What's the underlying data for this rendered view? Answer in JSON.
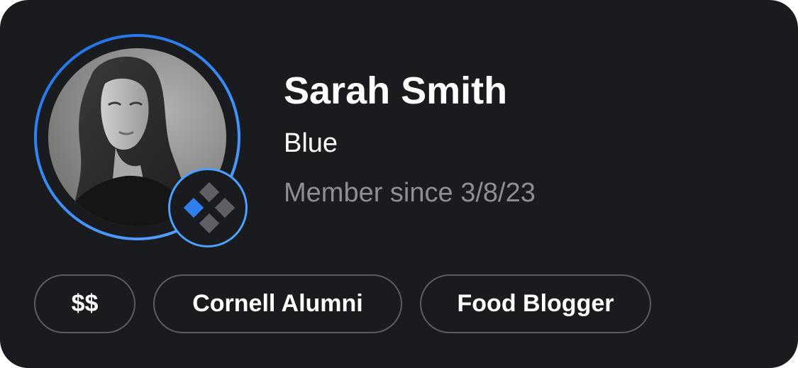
{
  "profile": {
    "name": "Sarah Smith",
    "tier": "Blue",
    "member_since": "Member since 3/8/23",
    "avatar_description": "black-and-white portrait photo",
    "tier_badge_icon": "diamond-grid-icon",
    "tags": [
      "$$",
      "Cornell Alumni",
      "Food Blogger"
    ]
  },
  "colors": {
    "background": "#1a1b1e",
    "accent": "#2f80ed",
    "ring_light": "#4da1ff",
    "muted_text": "#8e8f94",
    "tag_border": "#5b5c61"
  }
}
